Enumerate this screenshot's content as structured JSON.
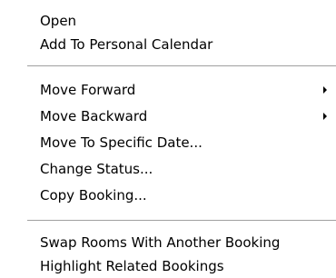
{
  "menu": {
    "items": [
      {
        "label": "Open"
      },
      {
        "label": "Add To Personal Calendar"
      },
      {
        "label": "Move Forward",
        "submenu_arrow": "submenu-arrow-icon"
      },
      {
        "label": "Move Backward",
        "submenu_arrow": "submenu-arrow-icon"
      },
      {
        "label": "Move To Specific Date..."
      },
      {
        "label": "Change Status..."
      },
      {
        "label": "Copy Booking..."
      },
      {
        "label": "Swap Rooms With Another Booking"
      },
      {
        "label": "Highlight Related Bookings"
      }
    ]
  }
}
